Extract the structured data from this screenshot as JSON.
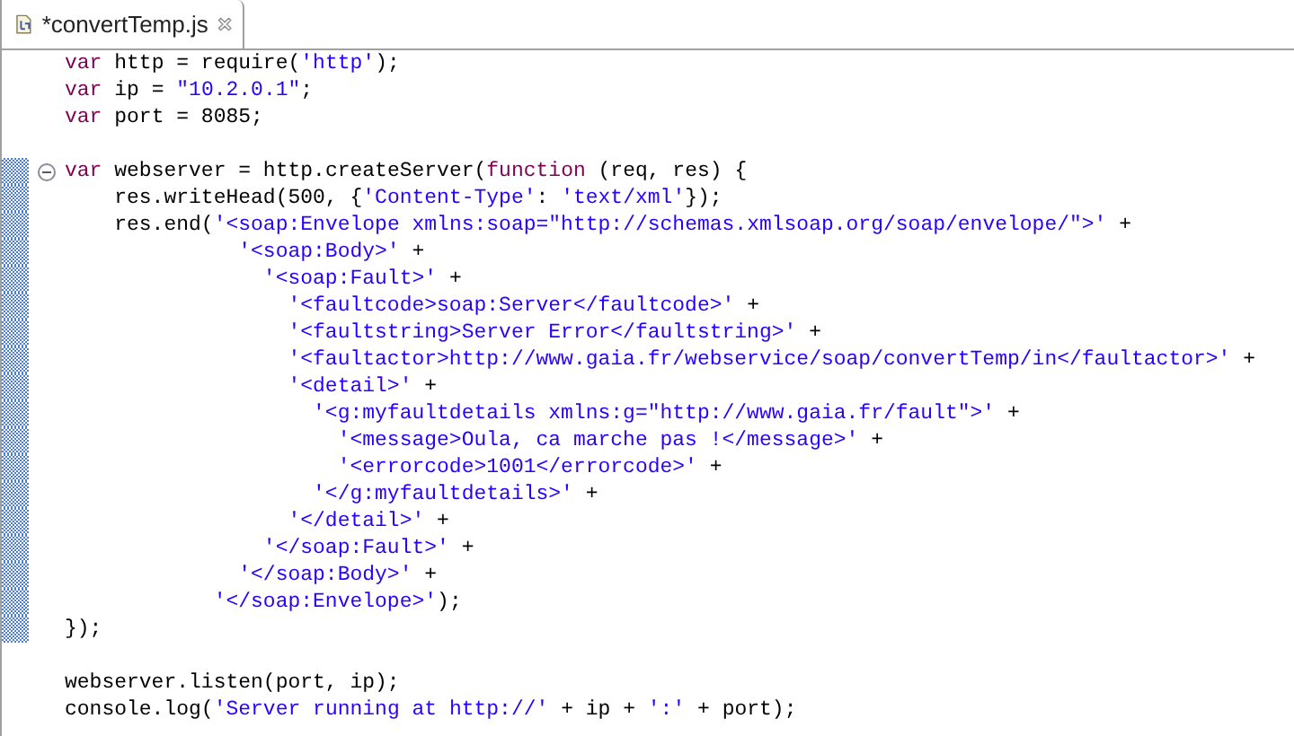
{
  "tab": {
    "title": "*convertTemp.js",
    "selected": true
  },
  "lines": [
    {
      "changed": false,
      "foldable": false,
      "tokens": [
        {
          "kind": "keyword",
          "text": "var"
        },
        {
          "kind": "plain",
          "text": " http = require("
        },
        {
          "kind": "string",
          "text": "'http'"
        },
        {
          "kind": "plain",
          "text": ");"
        }
      ]
    },
    {
      "changed": false,
      "foldable": false,
      "tokens": [
        {
          "kind": "keyword",
          "text": "var"
        },
        {
          "kind": "plain",
          "text": " ip = "
        },
        {
          "kind": "string",
          "text": "\"10.2.0.1\""
        },
        {
          "kind": "plain",
          "text": ";"
        }
      ]
    },
    {
      "changed": false,
      "foldable": false,
      "tokens": [
        {
          "kind": "keyword",
          "text": "var"
        },
        {
          "kind": "plain",
          "text": " port = 8085;"
        }
      ]
    },
    {
      "changed": false,
      "foldable": false
    },
    {
      "changed": true,
      "foldable": true,
      "tokens": [
        {
          "kind": "keyword",
          "text": "var"
        },
        {
          "kind": "plain",
          "text": " webserver = http.createServer("
        },
        {
          "kind": "keyword",
          "text": "function"
        },
        {
          "kind": "plain",
          "text": " (req, res) {"
        }
      ]
    },
    {
      "changed": true,
      "foldable": false,
      "tokens": [
        {
          "kind": "plain",
          "text": "    res.writeHead(500, {"
        },
        {
          "kind": "string",
          "text": "'Content-Type'"
        },
        {
          "kind": "plain",
          "text": ": "
        },
        {
          "kind": "string",
          "text": "'text/xml'"
        },
        {
          "kind": "plain",
          "text": "});"
        }
      ]
    },
    {
      "changed": true,
      "foldable": false,
      "tokens": [
        {
          "kind": "plain",
          "text": "    res.end("
        },
        {
          "kind": "string",
          "text": "'<soap:Envelope xmlns:soap=\"http://schemas.xmlsoap.org/soap/envelope/\">'"
        },
        {
          "kind": "plain",
          "text": " +"
        }
      ]
    },
    {
      "changed": true,
      "foldable": false,
      "tokens": [
        {
          "kind": "string",
          "text": "              '<soap:Body>'"
        },
        {
          "kind": "plain",
          "text": " +"
        }
      ]
    },
    {
      "changed": true,
      "foldable": false,
      "tokens": [
        {
          "kind": "string",
          "text": "                '<soap:Fault>'"
        },
        {
          "kind": "plain",
          "text": " +"
        }
      ]
    },
    {
      "changed": true,
      "foldable": false,
      "tokens": [
        {
          "kind": "string",
          "text": "                  '<faultcode>soap:Server</faultcode>'"
        },
        {
          "kind": "plain",
          "text": " +"
        }
      ]
    },
    {
      "changed": true,
      "foldable": false,
      "tokens": [
        {
          "kind": "string",
          "text": "                  '<faultstring>Server Error</faultstring>'"
        },
        {
          "kind": "plain",
          "text": " +"
        }
      ]
    },
    {
      "changed": true,
      "foldable": false,
      "tokens": [
        {
          "kind": "string",
          "text": "                  '<faultactor>http://www.gaia.fr/webservice/soap/convertTemp/in</faultactor>'"
        },
        {
          "kind": "plain",
          "text": " +"
        }
      ]
    },
    {
      "changed": true,
      "foldable": false,
      "tokens": [
        {
          "kind": "string",
          "text": "                  '<detail>'"
        },
        {
          "kind": "plain",
          "text": " +"
        }
      ]
    },
    {
      "changed": true,
      "foldable": false,
      "tokens": [
        {
          "kind": "string",
          "text": "                    '<g:myfaultdetails xmlns:g=\"http://www.gaia.fr/fault\">'"
        },
        {
          "kind": "plain",
          "text": " +"
        }
      ]
    },
    {
      "changed": true,
      "foldable": false,
      "tokens": [
        {
          "kind": "string",
          "text": "                      '<message>Oula, ca marche pas !</message>'"
        },
        {
          "kind": "plain",
          "text": " +"
        }
      ]
    },
    {
      "changed": true,
      "foldable": false,
      "tokens": [
        {
          "kind": "string",
          "text": "                      '<errorcode>1001</errorcode>'"
        },
        {
          "kind": "plain",
          "text": " +"
        }
      ]
    },
    {
      "changed": true,
      "foldable": false,
      "tokens": [
        {
          "kind": "string",
          "text": "                    '</g:myfaultdetails>'"
        },
        {
          "kind": "plain",
          "text": " +"
        }
      ]
    },
    {
      "changed": true,
      "foldable": false,
      "tokens": [
        {
          "kind": "string",
          "text": "                  '</detail>'"
        },
        {
          "kind": "plain",
          "text": " +"
        }
      ]
    },
    {
      "changed": true,
      "foldable": false,
      "tokens": [
        {
          "kind": "string",
          "text": "                '</soap:Fault>'"
        },
        {
          "kind": "plain",
          "text": " +"
        }
      ]
    },
    {
      "changed": true,
      "foldable": false,
      "tokens": [
        {
          "kind": "string",
          "text": "              '</soap:Body>'"
        },
        {
          "kind": "plain",
          "text": " +"
        }
      ]
    },
    {
      "changed": true,
      "foldable": false,
      "tokens": [
        {
          "kind": "string",
          "text": "            '</soap:Envelope>'"
        },
        {
          "kind": "plain",
          "text": ");"
        }
      ]
    },
    {
      "changed": true,
      "foldable": false,
      "tokens": [
        {
          "kind": "plain",
          "text": "});"
        }
      ]
    },
    {
      "changed": false,
      "foldable": false
    },
    {
      "changed": false,
      "foldable": false,
      "tokens": [
        {
          "kind": "plain",
          "text": "webserver.listen(port, ip);"
        }
      ]
    },
    {
      "changed": false,
      "foldable": false,
      "tokens": [
        {
          "kind": "plain",
          "text": "console.log("
        },
        {
          "kind": "string",
          "text": "'Server running at http://'"
        },
        {
          "kind": "plain",
          "text": " + ip + "
        },
        {
          "kind": "string",
          "text": "':'"
        },
        {
          "kind": "plain",
          "text": " + port);"
        }
      ]
    }
  ]
}
